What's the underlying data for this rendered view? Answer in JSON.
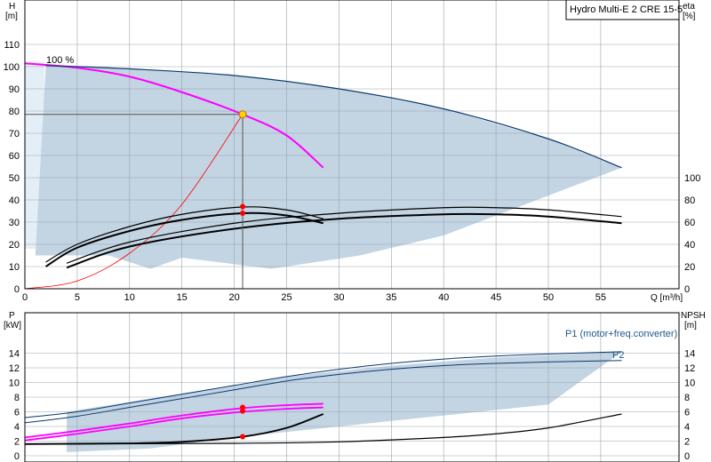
{
  "chart_data": [
    {
      "type": "line",
      "title": "Hydro Multi-E 2 CRE 15-5",
      "xlabel": "Q [m³/h]",
      "ylabel_left": "H",
      "ylabel_left_unit": "[m]",
      "ylabel_right": "eta",
      "ylabel_right_unit": "[%]",
      "xlim": [
        0,
        60
      ],
      "ylim_left": [
        0,
        120
      ],
      "ylim_right": [
        0,
        100
      ],
      "x_ticks": [
        0,
        5,
        10,
        15,
        20,
        25,
        30,
        35,
        40,
        45,
        50,
        55
      ],
      "y_ticks_left": [
        0,
        10,
        20,
        30,
        40,
        50,
        60,
        70,
        80,
        90,
        100,
        110
      ],
      "y_ticks_right": [
        0,
        20,
        40,
        60,
        80,
        100
      ],
      "grid": true,
      "annotations": [
        {
          "text": "100 %"
        }
      ],
      "operating_point": {
        "q": 20.8,
        "h": 78.5
      },
      "operating_region": {
        "top": [
          [
            2,
            100.5
          ],
          [
            10,
            99
          ],
          [
            20,
            96
          ],
          [
            30,
            90
          ],
          [
            40,
            81
          ],
          [
            50,
            67.5
          ],
          [
            57,
            54.5
          ]
        ],
        "bottom": [
          [
            57,
            54.5
          ],
          [
            40,
            24
          ],
          [
            32,
            15
          ],
          [
            23.5,
            9
          ],
          [
            15,
            14
          ],
          [
            12,
            9
          ],
          [
            8,
            15
          ],
          [
            1,
            15
          ]
        ]
      },
      "series": [
        {
          "role": "head_100pct",
          "color": "#ff00ff",
          "points": [
            [
              0,
              101.5
            ],
            [
              5,
              99.5
            ],
            [
              10,
              95.5
            ],
            [
              15,
              88.5
            ],
            [
              20.8,
              78.5
            ],
            [
              25,
              69
            ],
            [
              28.5,
              54.5
            ]
          ]
        },
        {
          "role": "system_curve",
          "color": "#ff0000",
          "points": [
            [
              0,
              0
            ],
            [
              5,
              3.5
            ],
            [
              10,
              16
            ],
            [
              15,
              38
            ],
            [
              20.8,
              78.5
            ]
          ]
        },
        {
          "role": "head_max",
          "color": "#0b3a6e",
          "points": [
            [
              2,
              100.5
            ],
            [
              10,
              99
            ],
            [
              20,
              96
            ],
            [
              30,
              90
            ],
            [
              40,
              81
            ],
            [
              50,
              67.5
            ],
            [
              57,
              54.5
            ]
          ]
        },
        {
          "role": "eta_100pct_thick",
          "color": "#000000",
          "points": [
            [
              2,
              10
            ],
            [
              5,
              18.5
            ],
            [
              10,
              26
            ],
            [
              15,
              31
            ],
            [
              20.8,
              34
            ],
            [
              25,
              33
            ],
            [
              28.5,
              29.5
            ]
          ]
        },
        {
          "role": "eta_100pct_thin",
          "color": "#000000",
          "points": [
            [
              2,
              12
            ],
            [
              5,
              20
            ],
            [
              10,
              28
            ],
            [
              15,
              33.5
            ],
            [
              20.8,
              36.8
            ],
            [
              25,
              35.5
            ],
            [
              28.5,
              31.5
            ]
          ]
        },
        {
          "role": "eta_max_thick",
          "color": "#000000",
          "points": [
            [
              4,
              9.5
            ],
            [
              10,
              19
            ],
            [
              20,
              27
            ],
            [
              30,
              31.5
            ],
            [
              40,
              33.5
            ],
            [
              45,
              33.5
            ],
            [
              50,
              32.5
            ],
            [
              57,
              29.5
            ]
          ]
        },
        {
          "role": "eta_max_thin",
          "color": "#000000",
          "points": [
            [
              4,
              11.5
            ],
            [
              10,
              21
            ],
            [
              20,
              29.5
            ],
            [
              30,
              34
            ],
            [
              40,
              36.5
            ],
            [
              45,
              36.5
            ],
            [
              50,
              35.5
            ],
            [
              57,
              32.5
            ]
          ]
        }
      ],
      "markers": [
        {
          "q": 20.8,
          "h": 37
        },
        {
          "q": 20.8,
          "h": 34
        }
      ]
    },
    {
      "type": "line",
      "xlabel": "",
      "ylabel_left": "P",
      "ylabel_left_unit": "[kW]",
      "ylabel_right": "NPSH",
      "ylabel_right_unit": "[m]",
      "xlim": [
        0,
        60
      ],
      "ylim_left": [
        0,
        16
      ],
      "ylim_right": [
        0,
        16
      ],
      "y_ticks_left": [
        0,
        2,
        4,
        6,
        8,
        10,
        12,
        14
      ],
      "y_ticks_right": [
        0,
        2,
        4,
        6,
        8,
        10,
        12,
        14
      ],
      "grid": true,
      "legend": [
        {
          "name": "P1 (motor+freq.converter)"
        },
        {
          "name": "P2"
        }
      ],
      "power_region": {
        "top": [
          [
            4,
            6
          ],
          [
            15,
            8.5
          ],
          [
            25,
            10.8
          ],
          [
            35,
            12.3
          ],
          [
            45,
            13.4
          ],
          [
            57,
            14.2
          ]
        ],
        "bottom": [
          [
            57,
            14.2
          ],
          [
            50,
            7
          ],
          [
            40,
            5.5
          ],
          [
            30,
            4
          ],
          [
            20,
            2.5
          ],
          [
            12,
            1
          ],
          [
            4,
            0.5
          ]
        ]
      },
      "series": [
        {
          "name": "P1 (motor+freq.converter)",
          "color": "#0b3a6e",
          "points": [
            [
              0,
              5.2
            ],
            [
              5,
              6
            ],
            [
              10,
              7.2
            ],
            [
              15,
              8.4
            ],
            [
              20,
              9.6
            ],
            [
              25,
              10.8
            ],
            [
              30,
              11.8
            ],
            [
              35,
              12.6
            ],
            [
              40,
              13.2
            ],
            [
              45,
              13.6
            ],
            [
              50,
              13.9
            ],
            [
              57,
              14.2
            ]
          ]
        },
        {
          "name": "P2",
          "color": "#0b3a6e",
          "points": [
            [
              0,
              4.5
            ],
            [
              5,
              5.4
            ],
            [
              10,
              6.6
            ],
            [
              15,
              7.8
            ],
            [
              20,
              9
            ],
            [
              25,
              10.2
            ],
            [
              30,
              11.1
            ],
            [
              35,
              11.8
            ],
            [
              40,
              12.3
            ],
            [
              45,
              12.6
            ],
            [
              50,
              12.8
            ],
            [
              57,
              13
            ]
          ]
        },
        {
          "role": "P1_100pct",
          "color": "#ff00ff",
          "points": [
            [
              0,
              2.5
            ],
            [
              5,
              3.4
            ],
            [
              10,
              4.4
            ],
            [
              15,
              5.5
            ],
            [
              20.8,
              6.5
            ],
            [
              25,
              6.9
            ],
            [
              28.5,
              7.1
            ]
          ]
        },
        {
          "role": "P2_100pct",
          "color": "#ff00ff",
          "points": [
            [
              0,
              2.1
            ],
            [
              5,
              3
            ],
            [
              10,
              4
            ],
            [
              15,
              5.1
            ],
            [
              20.8,
              6
            ],
            [
              25,
              6.4
            ],
            [
              28.5,
              6.6
            ]
          ]
        },
        {
          "role": "NPSH_100pct",
          "color": "#000000",
          "points": [
            [
              0,
              1.6
            ],
            [
              10,
              1.7
            ],
            [
              15,
              1.9
            ],
            [
              20.8,
              2.6
            ],
            [
              25,
              3.8
            ],
            [
              28.5,
              5.7
            ]
          ]
        },
        {
          "role": "NPSH_max",
          "color": "#000000",
          "points": [
            [
              0,
              1.6
            ],
            [
              20,
              1.7
            ],
            [
              30,
              1.9
            ],
            [
              40,
              2.5
            ],
            [
              45,
              3
            ],
            [
              50,
              3.8
            ],
            [
              57,
              5.7
            ]
          ]
        }
      ],
      "markers": [
        {
          "q": 20.8,
          "p": 6.6
        },
        {
          "q": 20.8,
          "p": 6.1
        },
        {
          "q": 20.8,
          "npsh": 2.6
        }
      ]
    }
  ]
}
